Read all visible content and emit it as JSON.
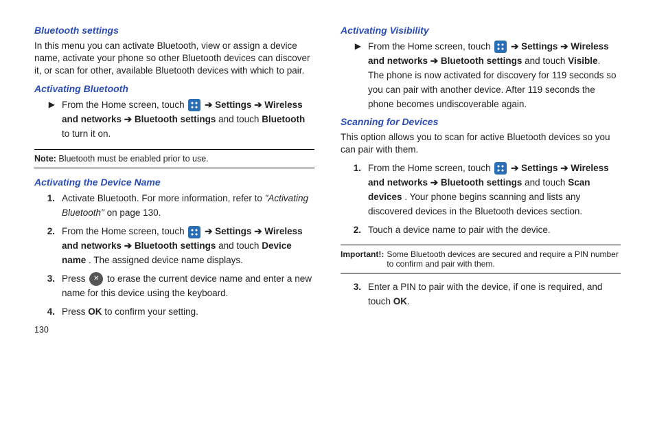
{
  "page_number": "130",
  "left": {
    "h_bt_settings": "Bluetooth settings",
    "p_bt_settings": "In this menu you can activate Bluetooth, view or assign a device name, activate your phone so other Bluetooth devices can discover it, or scan for other, available Bluetooth devices with which to pair.",
    "h_act_bt": "Activating Bluetooth",
    "act_bt_pre": "From the Home screen, touch ",
    "act_bt_post1": " ➔ ",
    "settings": "Settings",
    "wireless_net": "Wireless and networks",
    "bt_settings": "Bluetooth settings",
    "bluetooth": "Bluetooth",
    "act_bt_tail": " and touch ",
    "act_bt_end": " to turn it on.",
    "note_label": "Note:",
    "note_text": " Bluetooth must be enabled prior to use.",
    "h_dev_name": "Activating the Device Name",
    "dn1_a": "Activate Bluetooth. For more information, refer to ",
    "dn1_ref": "\"Activating Bluetooth\"",
    "dn1_b": "  on page 130.",
    "dn2_pre": "From the Home screen, touch ",
    "device_name": "Device name",
    "dn2_tail": ". The assigned device name displays.",
    "dn3_a": "Press ",
    "dn3_b": " to erase the current device name and enter a new name for this device using the keyboard.",
    "dn4_a": "Press ",
    "ok": "OK",
    "dn4_b": " to confirm your setting."
  },
  "right": {
    "h_vis": "Activating Visibility",
    "vis_pre": "From the Home screen, touch ",
    "visible": "Visible",
    "vis_tail": ".",
    "vis_body": "The phone is now activated for discovery  for 119 seconds so you can pair with another device. After 119 seconds the phone becomes undiscoverable again.",
    "h_scan": "Scanning for Devices",
    "scan_intro": "This option allows you to scan for active Bluetooth devices so you can pair with them.",
    "sc1_pre": "From the Home screen, touch ",
    "scan_devices": "Scan devices",
    "sc1_tail": ". Your phone begins scanning and lists any discovered devices in the Bluetooth devices section.",
    "sc2": "Touch a device name to pair with the device.",
    "imp_label": "Important!:",
    "imp_text": "Some Bluetooth devices are secured and require a PIN number to confirm and pair with them.",
    "sc3_a": "Enter a PIN to pair with the device, if one is required, and touch ",
    "sc3_b": "."
  },
  "arrow": "➔"
}
